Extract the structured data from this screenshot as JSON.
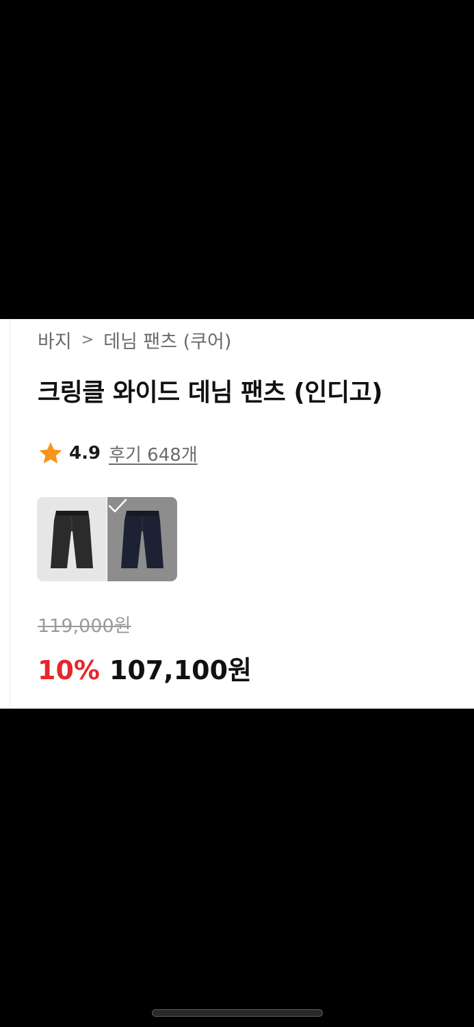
{
  "breadcrumb": {
    "category": "바지",
    "separator": ">",
    "subcategory": "데님 팬츠 (쿠어)"
  },
  "product": {
    "title": "크링클 와이드 데님 팬츠 (인디고)"
  },
  "rating": {
    "icon": "star-icon",
    "value": "4.9",
    "review_label": "후기 648개"
  },
  "color_options": [
    {
      "name": "black",
      "selected": false
    },
    {
      "name": "indigo",
      "selected": true
    }
  ],
  "price": {
    "original": "119,000원",
    "discount": "10%",
    "sale": "107,100원"
  },
  "colors": {
    "accent_red": "#e8262b",
    "star": "#f7941d",
    "text_primary": "#111111",
    "text_secondary": "#6b6b6b"
  }
}
